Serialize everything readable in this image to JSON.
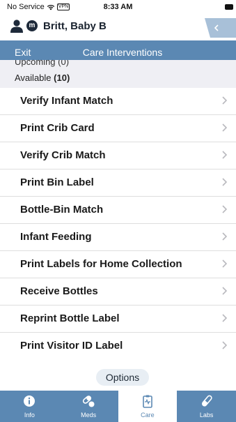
{
  "status_bar": {
    "carrier": "No Service",
    "vpn": "VPN",
    "time": "8:33 AM"
  },
  "patient": {
    "badge_letter": "m",
    "name": "Britt, Baby B"
  },
  "nav": {
    "exit_label": "Exit",
    "title": "Care Interventions"
  },
  "sections": {
    "upcoming_partial": "Upcoming (0)",
    "available_label": "Available",
    "available_count": "(10)"
  },
  "items": [
    {
      "label": "Verify Infant Match"
    },
    {
      "label": "Print Crib Card"
    },
    {
      "label": "Verify Crib Match"
    },
    {
      "label": "Print Bin Label"
    },
    {
      "label": "Bottle-Bin Match"
    },
    {
      "label": "Infant Feeding"
    },
    {
      "label": "Print Labels for Home Collection"
    },
    {
      "label": "Receive Bottles"
    },
    {
      "label": "Reprint Bottle Label"
    },
    {
      "label": "Print Visitor ID Label"
    }
  ],
  "options_label": "Options",
  "tabs": [
    {
      "label": "Info",
      "icon": "info-icon",
      "active": false
    },
    {
      "label": "Meds",
      "icon": "pills-icon",
      "active": false
    },
    {
      "label": "Care",
      "icon": "clipboard-heartbeat-icon",
      "active": true
    },
    {
      "label": "Labs",
      "icon": "test-tube-icon",
      "active": false
    }
  ],
  "colors": {
    "accent": "#5b88b3",
    "section_bg": "#efeff4",
    "options_bg": "#e8eef4"
  }
}
